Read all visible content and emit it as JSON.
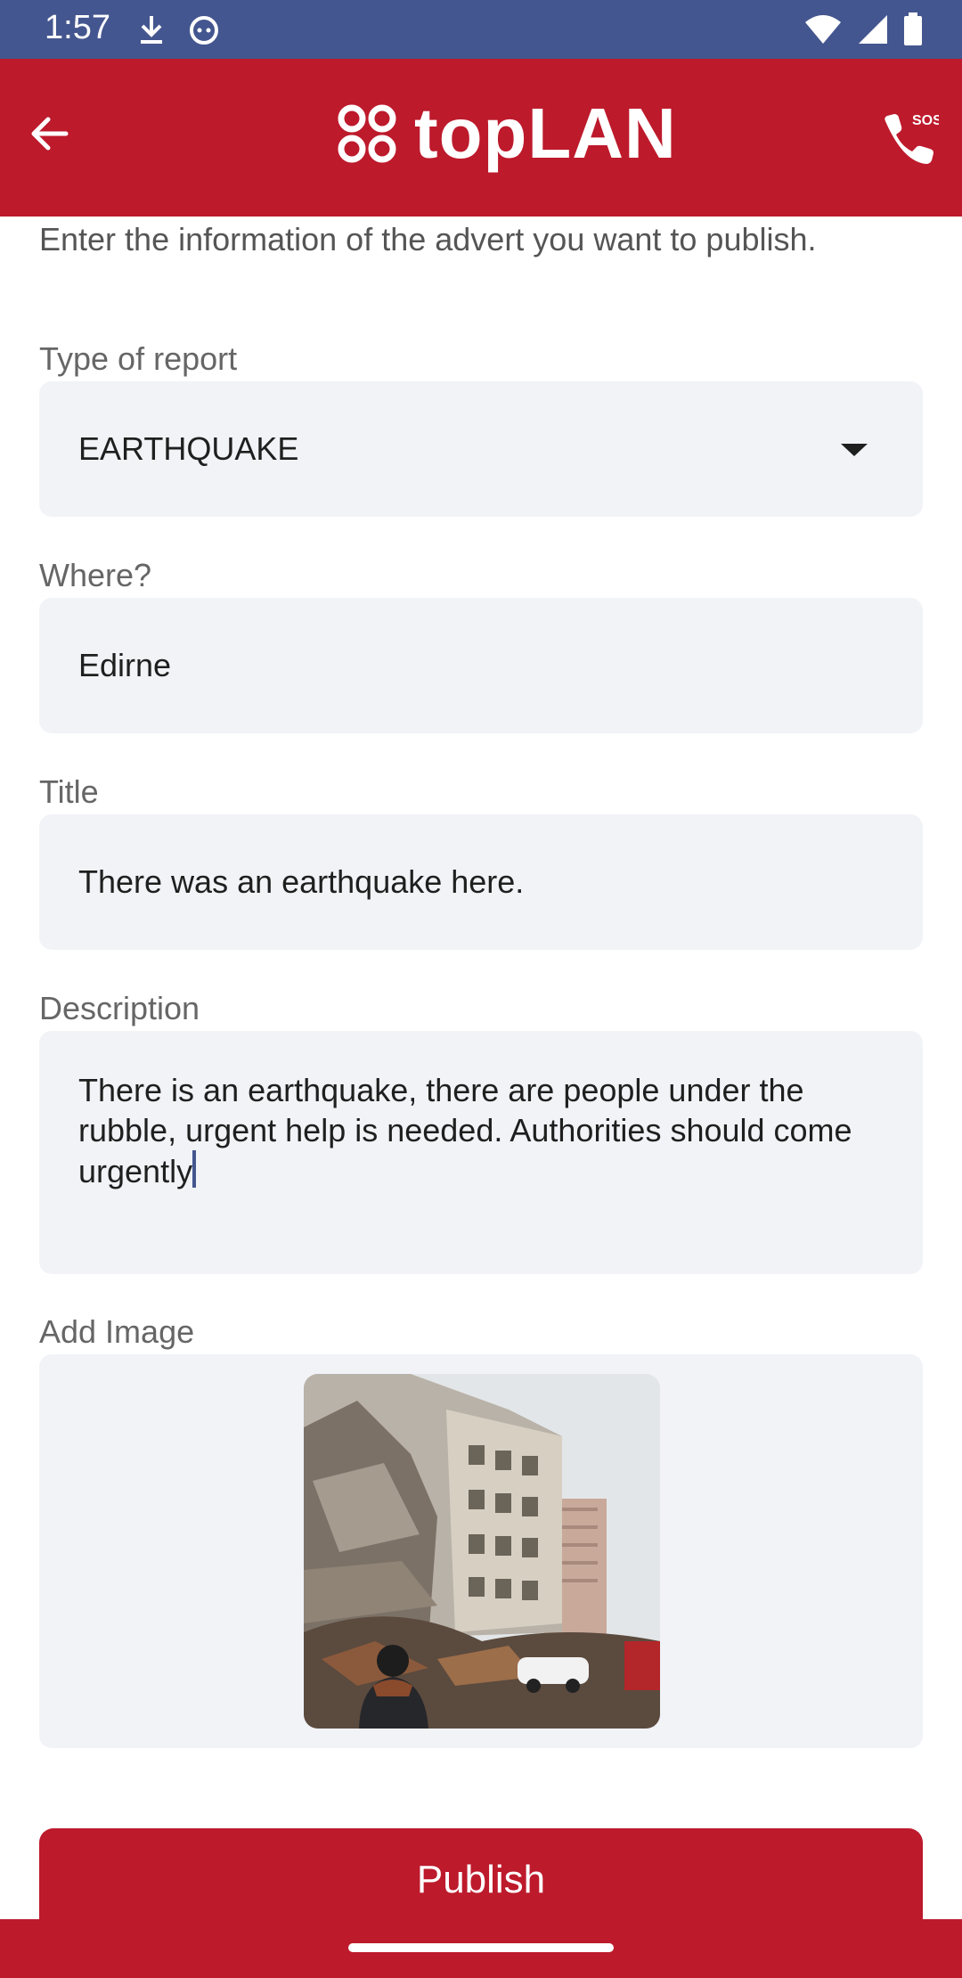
{
  "status_bar": {
    "time": "1:57",
    "icons_left": [
      "download-icon",
      "cat-face-icon"
    ],
    "icons_right": [
      "wifi-icon",
      "signal-icon",
      "battery-icon"
    ]
  },
  "app_bar": {
    "brand": "topLAN",
    "logo_icon": "cloverleaf-icon",
    "back_icon": "arrow-left-icon",
    "sos_icon": "phone-sos-icon",
    "sos_label": "SOS",
    "color": "#bd1a2c"
  },
  "intro_text": "Enter the information of the advert you want to publish.",
  "form": {
    "type_label": "Type of report",
    "type_value": "EARTHQUAKE",
    "where_label": "Where?",
    "where_value": "Edirne",
    "title_label": "Title",
    "title_value": "There was an earthquake here.",
    "description_label": "Description",
    "description_value": "There is an earthquake, there are people under the rubble, urgent help is needed. Authorities should come urgently",
    "image_label": "Add Image"
  },
  "publish_label": "Publish",
  "colors": {
    "accent": "#bd1a2c",
    "status_bar": "#44568f",
    "field_bg": "#f1f3f7"
  }
}
